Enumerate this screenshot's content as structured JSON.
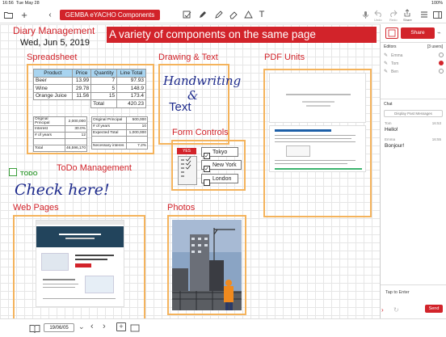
{
  "status_bar": {
    "time": "16:56",
    "date": "Tue May 28",
    "battery": "100%"
  },
  "toolbar": {
    "document_title": "GEMBA eYACHO Components",
    "undo_label": "Undo",
    "redo_label": "Redo",
    "share_label": "Share"
  },
  "page": {
    "diary_heading": "Diary Management",
    "diary_date": "Wed, Jun 5, 2019",
    "banner_text": "A variety of components on the same page",
    "spreadsheet_heading": "Spreadsheet",
    "drawing_heading": "Drawing & Text",
    "pdf_heading": "PDF Units",
    "form_heading": "Form Controls",
    "todo_heading": "ToDo Management",
    "todo_badge": "TODO",
    "todo_handwriting": "Check here!",
    "web_heading": "Web Pages",
    "photos_heading": "Photos",
    "handwriting_line1": "Handwriting",
    "handwriting_line2": "&",
    "text_sample": "Text"
  },
  "spreadsheet": {
    "headers": [
      "Product",
      "Price",
      "Quantity",
      "Line Total"
    ],
    "rows": [
      [
        "Beer",
        "13.99",
        "7",
        "97.93"
      ],
      [
        "Wine",
        "29.78",
        "5",
        "148.9"
      ],
      [
        "Orange Juice",
        "11.56",
        "15",
        "173.4"
      ],
      [
        "",
        "",
        "Total",
        "420.23"
      ]
    ],
    "loan_left": [
      [
        "Original Principal",
        "2,000,000"
      ],
      [
        "Interest",
        "30.0%"
      ],
      [
        "# of years",
        "12"
      ],
      [
        "",
        ""
      ],
      [
        "Total",
        "46,596,170"
      ]
    ],
    "loan_right": [
      [
        "Original Principal",
        "500,000"
      ],
      [
        "# of years",
        "10"
      ],
      [
        "Expected Total",
        "1,000,000"
      ],
      [
        "",
        ""
      ],
      [
        "Necessary interes",
        "7.2%"
      ]
    ]
  },
  "form_controls": {
    "badge": "YES",
    "options": [
      {
        "label": "Tokyo",
        "checked": true
      },
      {
        "label": "New York",
        "checked": true
      },
      {
        "label": "London",
        "checked": false
      }
    ]
  },
  "bottom_bar": {
    "page_label": "19/06/05"
  },
  "sidebar": {
    "share_button": "Share",
    "editors_label": "Editors",
    "users_count": "[3 users]",
    "editors": [
      {
        "name": "Emma",
        "active": false
      },
      {
        "name": "Tom",
        "active": true
      },
      {
        "name": "Ben",
        "active": false
      }
    ],
    "chat_label": "Chat",
    "display_past_messages": "Display Past Messages",
    "messages": [
      {
        "sender": "Tom",
        "time": "16:53",
        "text": "Hello!"
      },
      {
        "sender": "Emma",
        "time": "16:55",
        "text": "Bonjour!"
      }
    ],
    "input_placeholder": "Tap to Enter",
    "send_button": "Send"
  },
  "colors": {
    "accent": "#d2232a",
    "box_border": "#f4b35c",
    "table_header": "#a8d4f0",
    "ink": "#1d2a8c"
  }
}
